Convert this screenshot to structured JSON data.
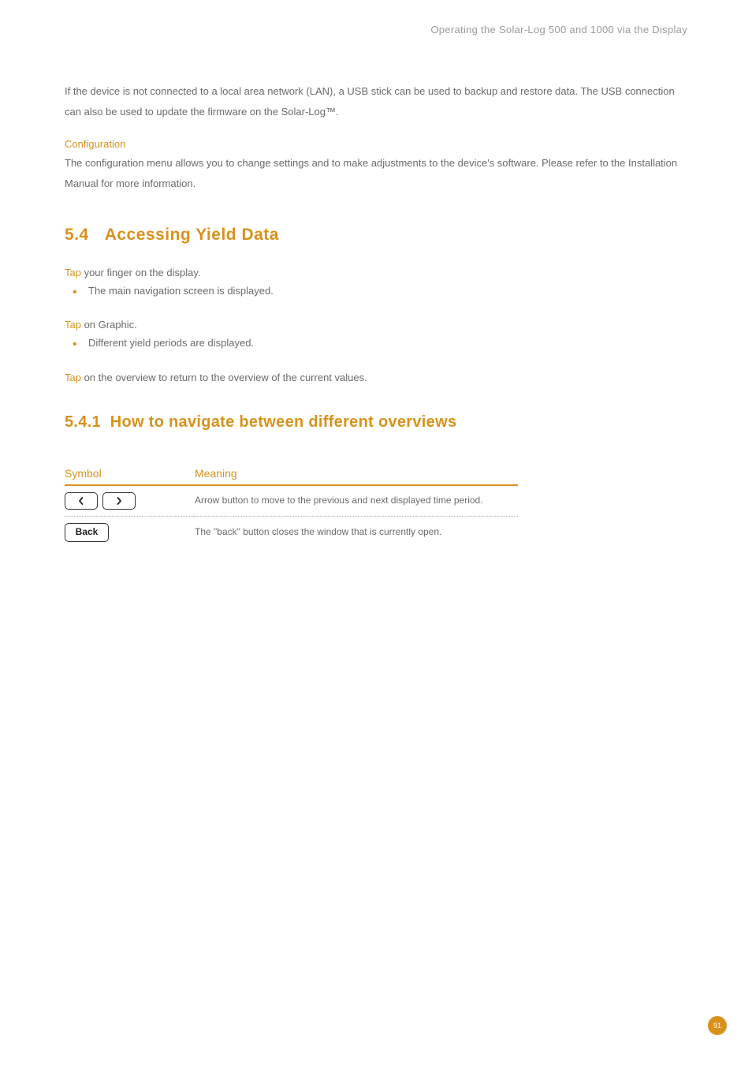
{
  "header": {
    "running_title": "Operating the Solar-Log 500 and 1000 via the Display"
  },
  "intro_paragraph": "If the device is not connected to a local area network (LAN), a USB stick can be used to backup and restore data. The USB connection can also be used to update the firmware on the Solar-Log™.",
  "config": {
    "title": "Configuration",
    "text": "The configuration menu allows you to change settings and to make adjustments to the device's software. Please refer to the Installation Manual for more information."
  },
  "section_5_4": {
    "number": "5.4",
    "title": "Accessing Yield Data",
    "tap1_prefix": "Tap",
    "tap1_rest": " your finger on the display.",
    "bullet1": "The main navigation screen is displayed.",
    "tap2_prefix": "Tap",
    "tap2_rest": " on Graphic.",
    "bullet2": "Different yield periods are displayed.",
    "tap3_prefix": "Tap",
    "tap3_rest": " on the overview to return to the overview of the current values."
  },
  "section_5_4_1": {
    "number": "5.4.1",
    "title": "How to navigate between different overviews",
    "table_headers": {
      "col1": "Symbol",
      "col2": "Meaning"
    },
    "rows": [
      {
        "symbol_type": "arrows",
        "back_label": "",
        "meaning": "Arrow button to move to the previous and next displayed time period."
      },
      {
        "symbol_type": "back",
        "back_label": "Back",
        "meaning": "The \"back\" button closes the window that is currently open."
      }
    ]
  },
  "page_number": "91"
}
